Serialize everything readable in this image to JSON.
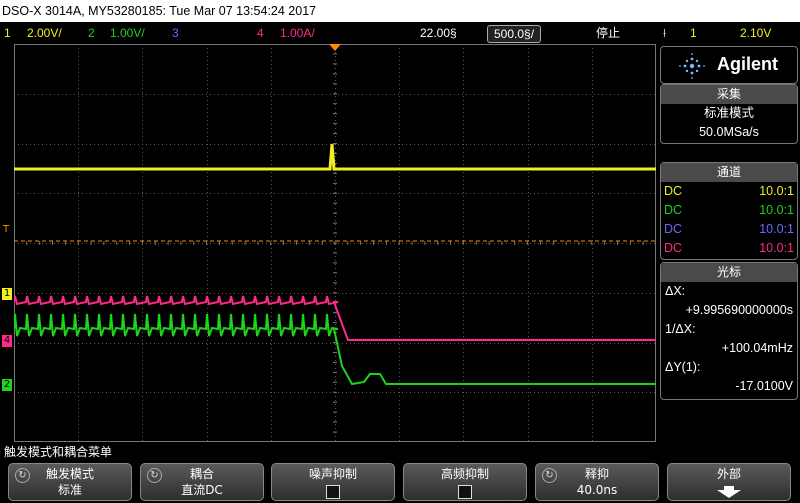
{
  "window": {
    "title": "DSO-X 3014A, MY53280185: Tue Mar 07 13:54:24 2017"
  },
  "status": {
    "ch1_num": "1",
    "ch1_scale": "2.00V/",
    "ch2_num": "2",
    "ch2_scale": "1.00V/",
    "ch3_num": "3",
    "ch4_num": "4",
    "ch4_scale": "1.00A/",
    "time_delay": "22.00§",
    "time_scale": "500.0§/",
    "run_state": "停止",
    "trig_source": "1",
    "trig_level": "2.10V"
  },
  "colors": {
    "ch1": "#f0f020",
    "ch2": "#1ed21e",
    "ch3": "#6a6aff",
    "ch4": "#ff2a8a",
    "grid": "#5a5a5a",
    "trigger": "#ff8c00"
  },
  "markers": {
    "trigger": "T",
    "ch1": "1",
    "ch2": "2",
    "ch4": "4"
  },
  "panel": {
    "brand": "Agilent",
    "acq": {
      "header": "采集",
      "mode": "标准模式",
      "rate": "50.0MSa/s"
    },
    "channels": {
      "header": "通道",
      "rows": [
        {
          "coupling": "DC",
          "probe": "10.0:1"
        },
        {
          "coupling": "DC",
          "probe": "10.0:1"
        },
        {
          "coupling": "DC",
          "probe": "10.0:1"
        },
        {
          "coupling": "DC",
          "probe": "10.0:1"
        }
      ]
    },
    "cursors": {
      "header": "光标",
      "dx_label": "ΔX:",
      "dx_value": "+9.995690000000s",
      "inv_label": "1/ΔX:",
      "inv_value": "+100.04mHz",
      "dy_label": "ΔY(1):",
      "dy_value": "-17.0100V"
    }
  },
  "menu": {
    "title": "触发模式和耦合菜单",
    "keys": [
      {
        "top": "触发模式",
        "bottom": "标准"
      },
      {
        "top": "耦合",
        "bottom": "直流DC"
      },
      {
        "top": "噪声抑制"
      },
      {
        "top": "高频抑制"
      },
      {
        "top": "释抑",
        "bottom": "40.0ns"
      },
      {
        "top": "外部"
      }
    ]
  }
}
